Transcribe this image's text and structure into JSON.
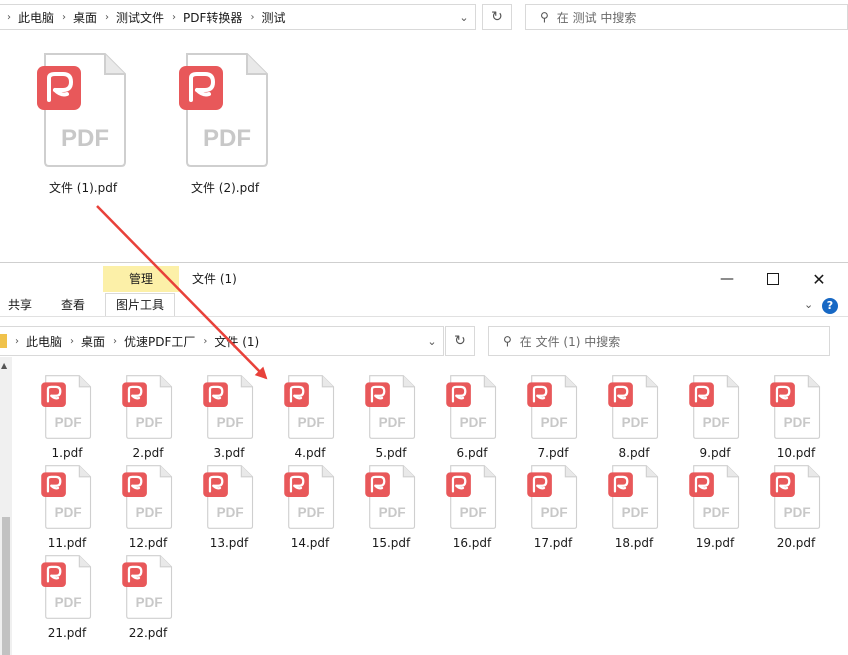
{
  "top_window": {
    "breadcrumbs": [
      "此电脑",
      "桌面",
      "测试文件",
      "PDF转换器",
      "测试"
    ],
    "search_placeholder": "在 测试 中搜索",
    "files": [
      {
        "name": "文件 (1).pdf",
        "icon": "pdf-file-icon"
      },
      {
        "name": "文件 (2).pdf",
        "icon": "pdf-file-icon"
      }
    ]
  },
  "bottom_window": {
    "context_tab": "管理",
    "title": "文件 (1)",
    "ribbon_tabs": [
      "共享",
      "查看",
      "图片工具"
    ],
    "breadcrumbs": [
      "此电脑",
      "桌面",
      "优速PDF工厂",
      "文件 (1)"
    ],
    "search_placeholder": "在 文件 (1) 中搜索",
    "files": [
      "1.pdf",
      "2.pdf",
      "3.pdf",
      "4.pdf",
      "5.pdf",
      "6.pdf",
      "7.pdf",
      "8.pdf",
      "9.pdf",
      "10.pdf",
      "11.pdf",
      "12.pdf",
      "13.pdf",
      "14.pdf",
      "15.pdf",
      "16.pdf",
      "17.pdf",
      "18.pdf",
      "19.pdf",
      "20.pdf",
      "21.pdf",
      "22.pdf"
    ]
  },
  "icons": {
    "pdf_badge_text": "PDF",
    "badge_color": "#e8585a",
    "accent_arrow_color": "#e8413a"
  }
}
